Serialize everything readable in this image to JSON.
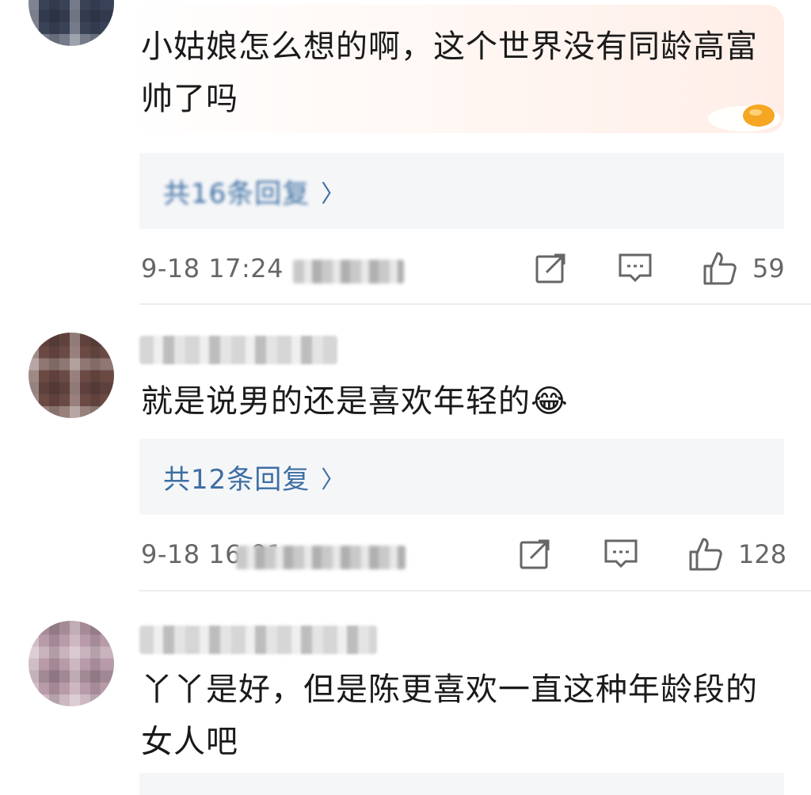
{
  "comments": [
    {
      "text": "小姑娘怎么想的啊，这个世界没有同龄高富帅了吗",
      "replies_label": "共16条回复",
      "time": "9-18 17:24",
      "location": "来自河北",
      "likes": "59"
    },
    {
      "text": "就是说男的还是喜欢年轻的",
      "emoji": "😂",
      "replies_label": "共12条回复",
      "time": "9-18 16:01",
      "location": "来自江苏",
      "likes": "128"
    },
    {
      "text": "丫丫是好，但是陈更喜欢一直这种年龄段的女人吧"
    }
  ],
  "icons": {
    "share": "share-icon",
    "comment": "comment-icon",
    "like": "thumbs-up-icon",
    "chevron": "chevron-right-icon"
  },
  "colors": {
    "link": "#3d6ea3",
    "meta": "#666666",
    "reply_bg": "#f5f6f8"
  }
}
